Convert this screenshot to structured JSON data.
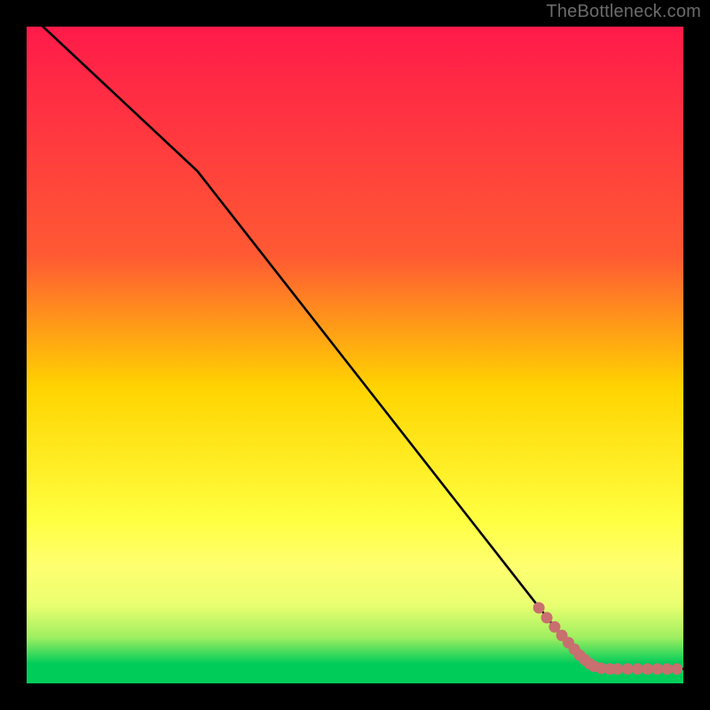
{
  "watermark": {
    "text": "TheBottleneck.com"
  },
  "colors": {
    "background": "#000000",
    "watermark_text": "#6b6b6b",
    "line_stroke": "#000000",
    "marker_fill": "#c86f6f",
    "marker_stroke": "#9e4a4a",
    "gradient_top": "#ff1a4a",
    "gradient_mid1": "#ff7a33",
    "gradient_mid2": "#ffd400",
    "gradient_mid3": "#ffff70",
    "gradient_bottom": "#00cc5a"
  },
  "chart_data": {
    "type": "line",
    "title": "",
    "xlabel": "",
    "ylabel": "",
    "xlim": [
      0,
      100
    ],
    "ylim": [
      0,
      100
    ],
    "grid": false,
    "legend": false,
    "series": [
      {
        "name": "curve",
        "x": [
          2.5,
          26,
          82,
          86,
          100
        ],
        "values": [
          100,
          78,
          6.5,
          2.2,
          2.2
        ]
      }
    ],
    "markers": {
      "name": "points-cluster",
      "x": [
        78,
        79.2,
        80.4,
        81.5,
        82.5,
        83.4,
        84.2,
        85,
        85.7,
        86.4,
        87.5,
        88.8,
        90,
        91.5,
        93,
        94.5,
        96,
        97.5,
        99
      ],
      "values": [
        11.5,
        10,
        8.6,
        7.3,
        6.2,
        5.2,
        4.3,
        3.6,
        3,
        2.6,
        2.3,
        2.2,
        2.2,
        2.2,
        2.2,
        2.2,
        2.2,
        2.2,
        2.2
      ]
    },
    "gradient_bands_pct": [
      0,
      70,
      78,
      85,
      90,
      95,
      100
    ]
  }
}
